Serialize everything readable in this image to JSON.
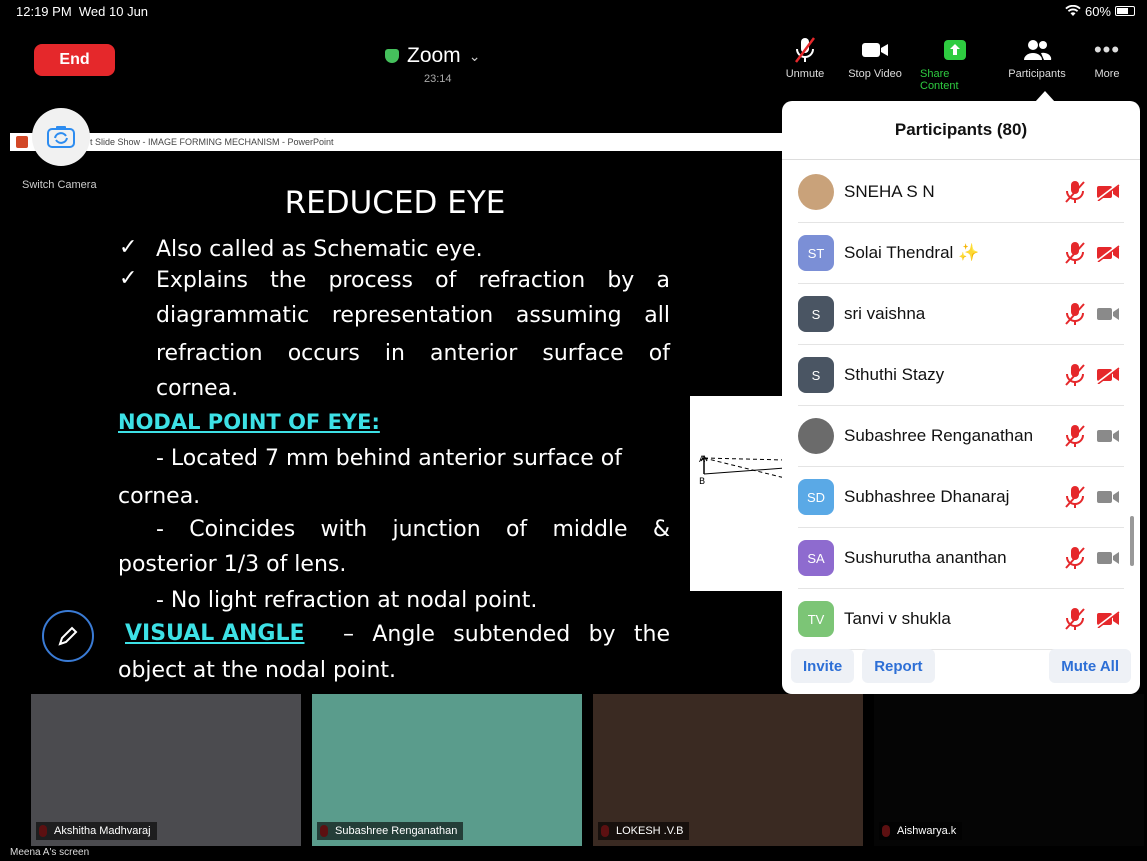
{
  "status_bar": {
    "time": "12:19 PM",
    "date": "Wed 10 Jun",
    "wifi": "wifi-icon",
    "battery": "60%"
  },
  "top_bar": {
    "end_label": "End",
    "meeting_name": "Zoom",
    "meeting_time": "23:14",
    "toolbar": [
      {
        "label": "Unmute",
        "icon": "mic-muted-icon"
      },
      {
        "label": "Stop Video",
        "icon": "video-icon"
      },
      {
        "label": "Share Content",
        "icon": "share-icon"
      },
      {
        "label": "Participants",
        "icon": "participants-icon"
      },
      {
        "label": "More",
        "icon": "more-icon"
      }
    ]
  },
  "shared_window": {
    "title": "t Slide Show - IMAGE FORMING MECHANISM - PowerPoint"
  },
  "switch_camera": {
    "label": "Switch Camera"
  },
  "slide": {
    "title": "REDUCED EYE",
    "bullet1": "Also called as Schematic eye.",
    "bullet2_l1": "Explains the process of refraction by a",
    "bullet2_l2": "diagrammatic representation assuming all",
    "bullet2_l3": "refraction occurs in anterior surface of",
    "bullet2_l4": "cornea.",
    "nodal_heading": "NODAL POINT OF EYE:",
    "nodal1_l1": "- Located 7 mm behind anterior surface of",
    "nodal1_l2": "cornea.",
    "nodal2_l1": "- Coincides with junction of middle &",
    "nodal2_l2": "posterior 1/3 of lens.",
    "nodal3": "- No light refraction at nodal point.",
    "visual_heading": "VISUAL ANGLE",
    "visual_text_l1": "– Angle subtended by the",
    "visual_text_l2": "object at the nodal point.",
    "diagram_label_a": "A",
    "diagram_label_b": "B"
  },
  "participants_panel": {
    "title": "Participants (80)",
    "participants": [
      {
        "name": "SNEHA S N",
        "initials": "",
        "avatar_color": "#c9a27a",
        "video_off": true
      },
      {
        "name": "Solai Thendral ✨",
        "initials": "ST",
        "avatar_color": "#7b8fd6",
        "video_off": true
      },
      {
        "name": "sri vaishna",
        "initials": "S",
        "avatar_color": "#4a5563",
        "video_off": false
      },
      {
        "name": "Sthuthi Stazy",
        "initials": "S",
        "avatar_color": "#4a5563",
        "video_off": true
      },
      {
        "name": "Subashree Renganathan",
        "initials": "",
        "avatar_color": "#6b6b6b",
        "video_off": false
      },
      {
        "name": "Subhashree Dhanaraj",
        "initials": "SD",
        "avatar_color": "#5aa9e6",
        "video_off": false
      },
      {
        "name": "Sushurutha ananthan",
        "initials": "SA",
        "avatar_color": "#8e6bcf",
        "video_off": false
      },
      {
        "name": "Tanvi v shukla",
        "initials": "TV",
        "avatar_color": "#7cc576",
        "video_off": true
      }
    ],
    "invite_label": "Invite",
    "report_label": "Report",
    "mute_all_label": "Mute All"
  },
  "video_tiles": [
    {
      "name": "Akshitha Madhvaraj",
      "bg": "#4b4b4f"
    },
    {
      "name": "Subashree Renganathan",
      "bg": "#5a9c8c"
    },
    {
      "name": "LOKESH .V.B",
      "bg": "#3a2a22"
    },
    {
      "name": "Aishwarya.k",
      "bg": "#050505"
    }
  ],
  "screen_owner": "Meena A's screen",
  "colors": {
    "end_red": "#e5282b",
    "accent_blue": "#2d6fd6",
    "share_green": "#2ecc40",
    "heading_cyan": "#3de1e6"
  }
}
